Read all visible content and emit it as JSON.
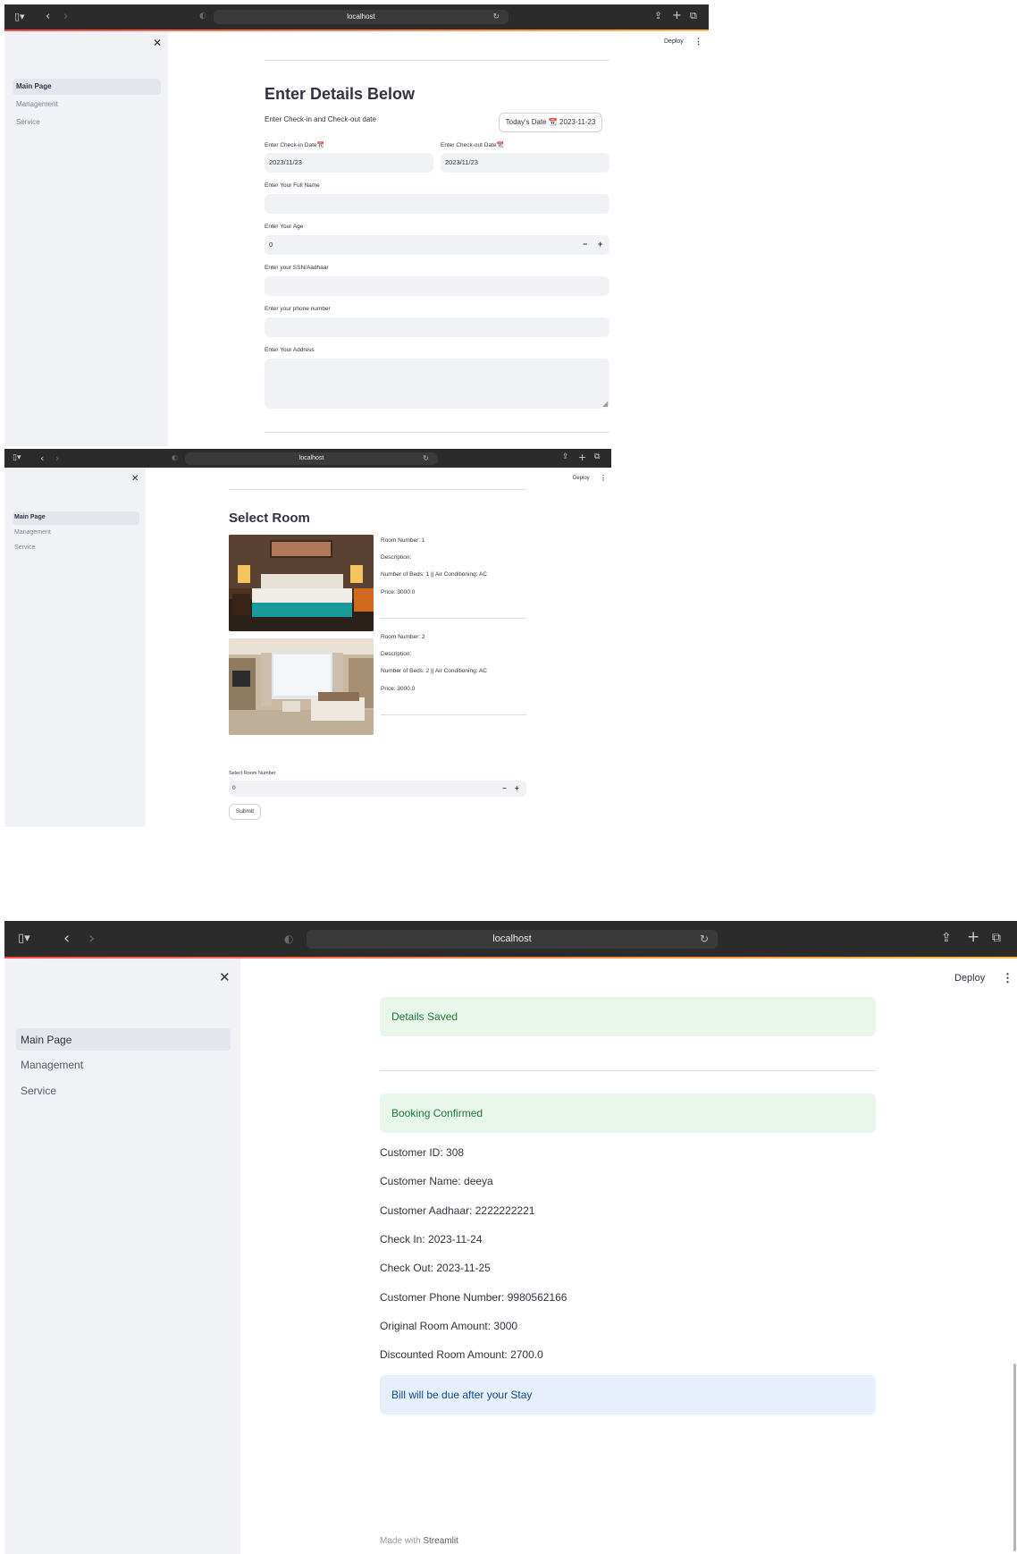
{
  "browser": {
    "url": "localhost"
  },
  "header": {
    "deploy_label": "Deploy",
    "menu_icon": "kebab-icon"
  },
  "sidebar": {
    "close_icon": "close-icon",
    "items": [
      {
        "label": "Main Page",
        "active": true
      },
      {
        "label": "Management",
        "active": false
      },
      {
        "label": "Service",
        "active": false
      }
    ]
  },
  "details_form": {
    "title": "Enter Details Below",
    "subtitle": "Enter Check-in and Check-out date",
    "todays_date_button": "Today's Date 📆 2023-11-23",
    "checkin_label": "Enter Check-in Date📆",
    "checkin_value": "2023/11/23",
    "checkout_label": "Enter Check-out Date📆",
    "checkout_value": "2023/11/23",
    "name_label": "Enter Your Full Name",
    "name_value": "",
    "age_label": "Enter Your Age",
    "age_value": "0",
    "ssn_label": "Enter your SSN/Aadhaar",
    "ssn_value": "",
    "phone_label": "Enter your phone number",
    "phone_value": "",
    "address_label": "Enter Your Address",
    "address_value": ""
  },
  "select_room": {
    "title": "Select Room",
    "rooms": [
      {
        "number_text": "Room Number: 1",
        "description_text": "Description:",
        "beds_ac_text": "Number of Beds: 1 || Air Conditioning: AC",
        "price_text": "Price: 3000.0"
      },
      {
        "number_text": "Room Number: 2",
        "description_text": "Description:",
        "beds_ac_text": "Number of Beds: 2 || Air Conditioning: AC",
        "price_text": "Price: 3000.0"
      }
    ],
    "room_number_label": "Select Room Number",
    "room_number_value": "0",
    "submit_label": "Submit"
  },
  "confirmation": {
    "details_saved": "Details Saved",
    "booking_confirmed": "Booking Confirmed",
    "lines": [
      "Customer ID: 308",
      "Customer Name: deeya",
      "Customer Aadhaar: 2222222221",
      "Check In: 2023-11-24",
      "Check Out: 2023-11-25",
      "Customer Phone Number: 9980562166",
      "Original Room Amount: 3000",
      "Discounted Room Amount: 2700.0"
    ],
    "bill_info": "Bill will be due after your Stay"
  },
  "footer": {
    "made_with": "Made with",
    "brand": "Streamlit"
  },
  "colors": {
    "sidebar_bg": "#f0f2f6",
    "success_bg": "#e8f6ec",
    "info_bg": "#e6effb",
    "toolbar_bg": "#2b2b2b"
  }
}
